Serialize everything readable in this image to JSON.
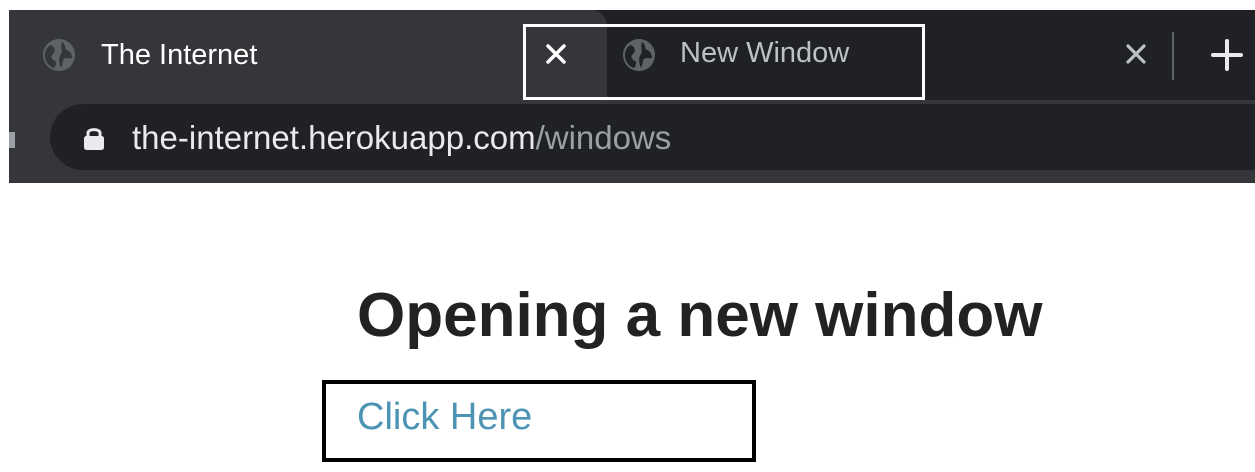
{
  "browser": {
    "tabs": [
      {
        "title": "The Internet",
        "icon": "globe-icon",
        "active": true
      },
      {
        "title": "New Window",
        "icon": "globe-icon",
        "active": false
      }
    ],
    "new_tab_icon": "plus-icon",
    "address_bar": {
      "lock_icon": "lock-icon",
      "domain": "the-internet.herokuapp.com",
      "path": "/windows"
    }
  },
  "page": {
    "heading": "Opening a new window",
    "link_text": "Click Here"
  },
  "colors": {
    "tabstrip_bg": "#202124",
    "active_tab_bg": "#35363a",
    "link": "#4c93b4",
    "heading": "#222222",
    "url_path": "#9aa0a6"
  }
}
